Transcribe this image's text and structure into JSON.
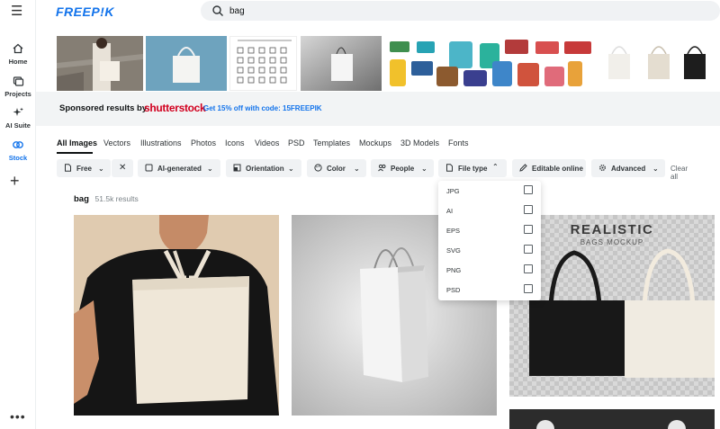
{
  "sidebar": {
    "items": [
      {
        "label": "Home"
      },
      {
        "label": "Projects"
      },
      {
        "label": "AI Suite"
      },
      {
        "label": "Stock"
      }
    ]
  },
  "header": {
    "logo": "FREEP!K",
    "search_value": "bag"
  },
  "sponsored": {
    "label": "Sponsored results by",
    "brand": "shutterstock",
    "promo": "Get 15% off with code: 15FREEPIK"
  },
  "tabs": [
    "All Images",
    "Vectors",
    "Illustrations",
    "Photos",
    "Icons",
    "Videos",
    "PSD",
    "Templates",
    "Mockups",
    "3D Models",
    "Fonts"
  ],
  "filters": {
    "free": "Free",
    "ai_generated": "AI-generated",
    "orientation": "Orientation",
    "color": "Color",
    "people": "People",
    "file_type": "File type",
    "editable_online": "Editable online",
    "advanced": "Advanced",
    "clear_all": "Clear all"
  },
  "results": {
    "query": "bag",
    "count": "51.5k results"
  },
  "file_type_options": [
    "JPG",
    "AI",
    "EPS",
    "SVG",
    "PNG",
    "PSD"
  ],
  "mockup_text": {
    "title": "REALISTIC",
    "subtitle": "BAGS MOCKUP"
  },
  "colors": {
    "brand_blue": "#1273eb",
    "shutterstock_red": "#d1001f",
    "pill_bg": "#f0f2f4"
  }
}
